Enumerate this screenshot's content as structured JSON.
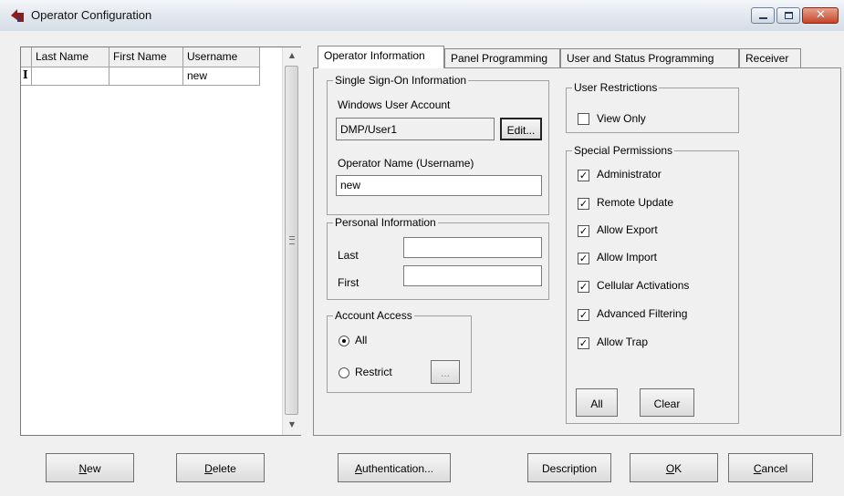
{
  "window": {
    "title": "Operator Configuration"
  },
  "grid": {
    "columns": [
      "Last Name",
      "First Name",
      "Username"
    ],
    "rows": [
      {
        "marker": "I",
        "last": "",
        "first": "",
        "username": "new"
      }
    ]
  },
  "tabs": [
    "Operator Information",
    "Panel Programming",
    "User and Status Programming",
    "Receiver"
  ],
  "sso": {
    "legend": "Single Sign-On Information",
    "account_label": "Windows User Account",
    "account_value": "DMP/User1",
    "edit_button": "Edit...",
    "operator_label": "Operator Name (Username)",
    "operator_value": "new"
  },
  "personal": {
    "legend": "Personal Information",
    "last_label": "Last",
    "last_value": "",
    "first_label": "First",
    "first_value": ""
  },
  "access": {
    "legend": "Account Access",
    "all_label": "All",
    "restrict_label": "Restrict",
    "ellipsis": "...",
    "selected": "All"
  },
  "restrictions": {
    "legend": "User Restrictions",
    "view_only": "View Only",
    "view_only_checked": false
  },
  "permissions": {
    "legend": "Special Permissions",
    "items": [
      {
        "label": "Administrator",
        "checked": true
      },
      {
        "label": "Remote Update",
        "checked": true
      },
      {
        "label": "Allow Export",
        "checked": true
      },
      {
        "label": "Allow Import",
        "checked": true
      },
      {
        "label": "Cellular Activations",
        "checked": true
      },
      {
        "label": "Advanced Filtering",
        "checked": true
      },
      {
        "label": "Allow Trap",
        "checked": true
      }
    ],
    "all_button": "All",
    "clear_button": "Clear"
  },
  "buttons": {
    "new": {
      "hot": "N",
      "rest": "ew"
    },
    "delete": {
      "hot": "D",
      "rest": "elete"
    },
    "authentication": {
      "hot": "A",
      "rest": "uthentication..."
    },
    "description": "Description",
    "ok": {
      "hot": "O",
      "rest": "K"
    },
    "cancel": {
      "hot": "C",
      "rest": "ancel"
    }
  },
  "colors": {
    "titlebar": "#dfe6ef",
    "client": "#f0f0f0",
    "close": "#c5452a"
  }
}
